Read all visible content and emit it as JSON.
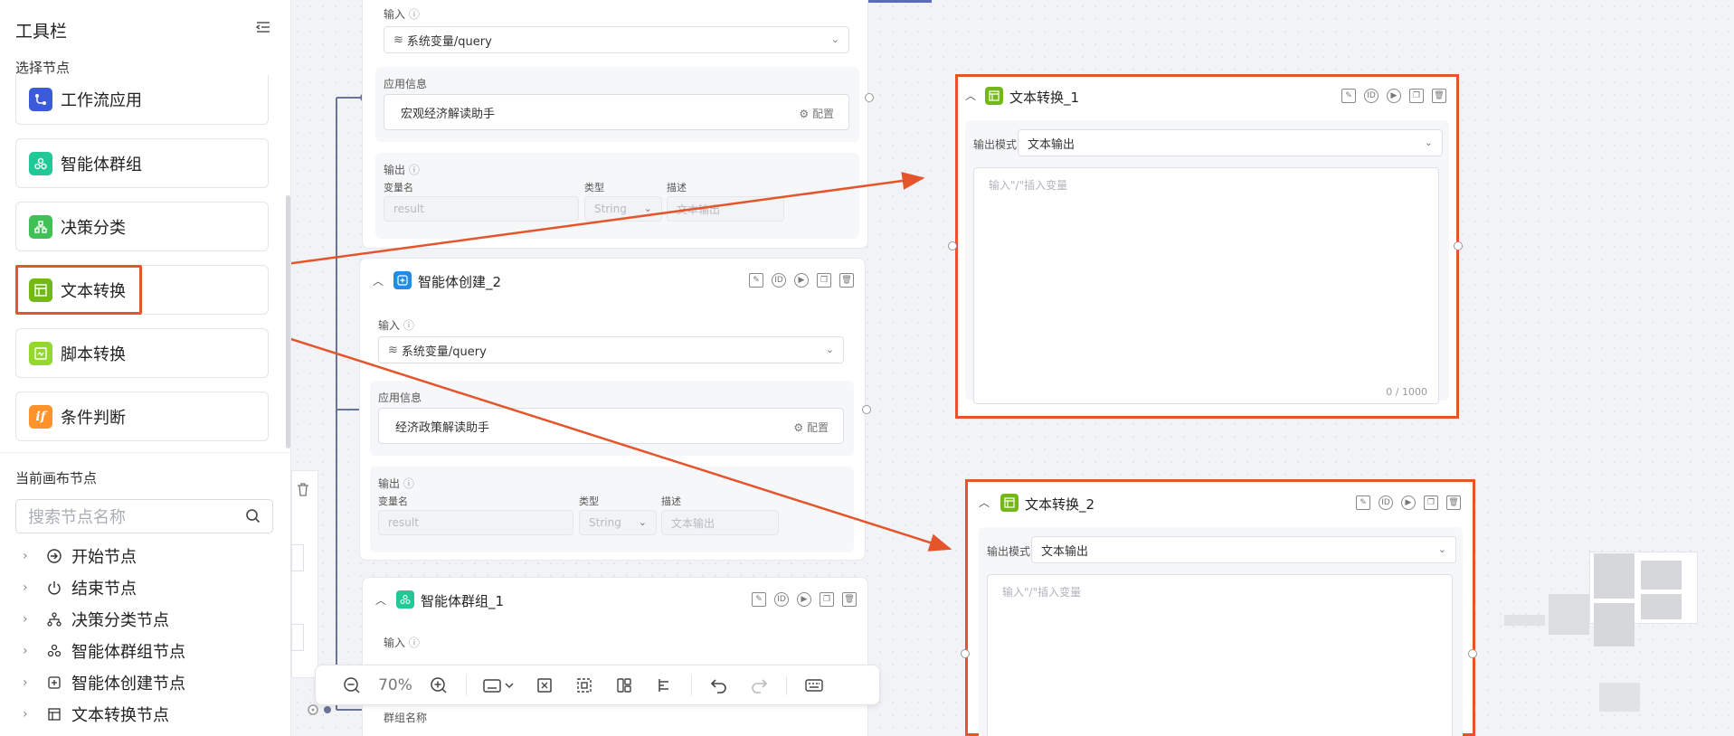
{
  "toolbar": {
    "title": "工具栏",
    "select_nodes_label": "选择节点",
    "node_types": [
      {
        "label": "工作流应用",
        "icon": "workflow-icon",
        "color": "#3b5bdb"
      },
      {
        "label": "智能体群组",
        "icon": "agent-group-icon",
        "color": "#20c997"
      },
      {
        "label": "决策分类",
        "icon": "decision-icon",
        "color": "#40c057"
      },
      {
        "label": "文本转换",
        "icon": "text-transform-icon",
        "color": "#74b816"
      },
      {
        "label": "脚本转换",
        "icon": "script-icon",
        "color": "#94d82d"
      },
      {
        "label": "条件判断",
        "icon": "condition-icon",
        "color": "#ff922b"
      }
    ],
    "current_nodes_label": "当前画布节点",
    "search_placeholder": "搜索节点名称",
    "tree": [
      {
        "label": "开始节点",
        "icon": "start-icon"
      },
      {
        "label": "结束节点",
        "icon": "power-icon"
      },
      {
        "label": "决策分类节点",
        "icon": "decision-icon"
      },
      {
        "label": "智能体群组节点",
        "icon": "agent-group-icon"
      },
      {
        "label": "智能体创建节点",
        "icon": "agent-create-icon"
      },
      {
        "label": "文本转换节点",
        "icon": "text-transform-icon"
      }
    ]
  },
  "canvas": {
    "card_top": {
      "input_label": "输入",
      "input_value": "系统变量/query",
      "app_info_label": "应用信息",
      "app_name": "宏观经济解读助手",
      "config_label": "配置",
      "output_label": "输出",
      "col_varname": "变量名",
      "col_type": "类型",
      "col_desc": "描述",
      "var_value": "result",
      "type_value": "String",
      "desc_value": "文本输出"
    },
    "card_agent_create": {
      "title": "智能体创建_2",
      "input_label": "输入",
      "input_value": "系统变量/query",
      "app_info_label": "应用信息",
      "app_name": "经济政策解读助手",
      "config_label": "配置",
      "output_label": "输出",
      "col_varname": "变量名",
      "col_type": "类型",
      "col_desc": "描述",
      "var_value": "result",
      "type_value": "String",
      "desc_value": "文本输出"
    },
    "card_agent_group": {
      "title": "智能体群组_1",
      "input_label": "输入",
      "group_name_label": "群组名称"
    },
    "text_node_1": {
      "title": "文本转换_1",
      "mode_label": "输出模式",
      "mode_value": "文本输出",
      "textarea_placeholder": "输入\"/\"插入变量",
      "counter": "0 / 1000"
    },
    "text_node_2": {
      "title": "文本转换_2",
      "mode_label": "输出模式",
      "mode_value": "文本输出",
      "textarea_placeholder": "输入\"/\"插入变量"
    }
  },
  "controls": {
    "zoom": "70%"
  },
  "colors": {
    "highlight": "#e4552b",
    "accent": "#3b5bdb"
  }
}
